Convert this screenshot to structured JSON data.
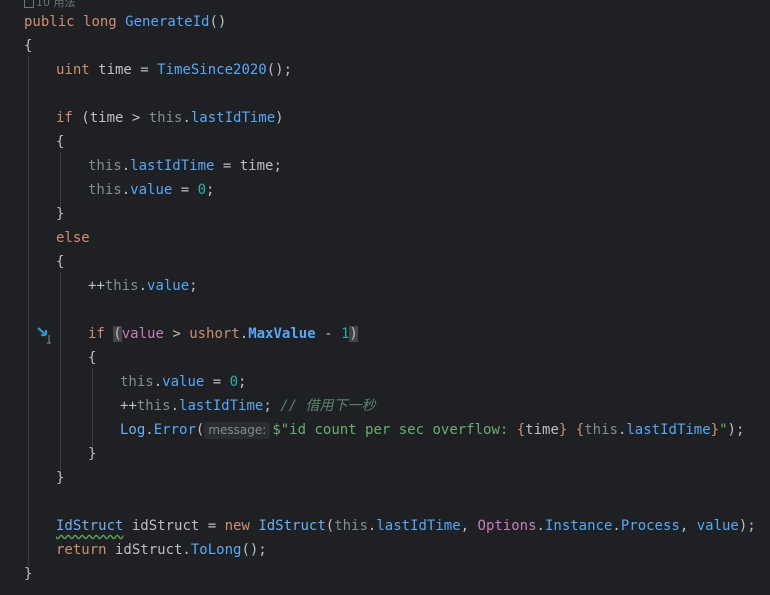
{
  "usages_hint": "10 用法",
  "code": {
    "sig_public": "public",
    "sig_long": "long",
    "sig_name": "GenerateId",
    "sig_parens": "()",
    "open_brace": "{",
    "close_brace": "}",
    "l3_uint": "uint",
    "l3_rest1": " time = ",
    "l3_call": "TimeSince2020",
    "l3_rest2": "();",
    "l5_if": "if",
    "l5_a": " (time > ",
    "this": "this",
    "dot": ".",
    "lastIdTime": "lastIdTime",
    "l5_close": ")",
    "l7_rest": " = time;",
    "value": "value",
    "l8_eq": " = ",
    "zero": "0",
    "semicolon": ";",
    "else": "else",
    "incr": "++",
    "l14_open": "(",
    "l14_value": "value",
    "l14_gt": " > ",
    "ushort": "ushort",
    "maxvalue": "MaxValue",
    "l14_minus": " - ",
    "one": "1",
    "l14_close": ")",
    "comment": "// 借用下一秒",
    "log": "Log",
    "error": "Error",
    "paren_open": "(",
    "hint_message": "message:",
    "str_a": "$\"id count per sec overflow: ",
    "interp_open": "{",
    "time": "time",
    "interp_close": "}",
    "space": " ",
    "str_end": "\"",
    "l18_end": ");",
    "idstruct_type": "IdStruct",
    "l22_var": " idStruct = ",
    "new": "new",
    "comma": ", ",
    "options": "Options",
    "instance": "Instance",
    "process": "Process",
    "return": "return",
    "l23_var": " idStruct.",
    "tolong": "ToLong",
    "l23_end": "();"
  }
}
